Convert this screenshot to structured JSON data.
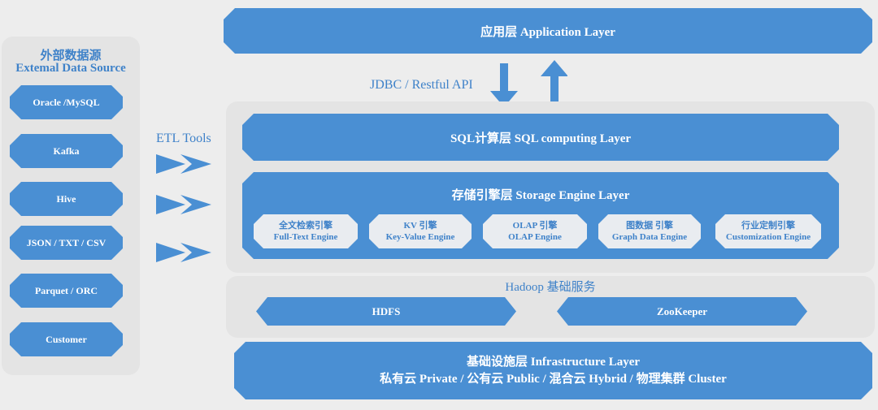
{
  "external": {
    "title_cn": "外部数据源",
    "title_en": "Extemal Data Source",
    "sources": [
      "Oracle /MySQL",
      "Kafka",
      "Hive",
      "JSON / TXT / CSV",
      "Parquet / ORC",
      "Customer"
    ]
  },
  "etl_label": "ETL Tools",
  "application_layer": "应用层 Application Layer",
  "api_label": "JDBC /  Restful API",
  "sql_layer": "SQL计算层   SQL computing Layer",
  "storage": {
    "title": "存储引擎层   Storage Engine Layer",
    "engines": [
      {
        "cn": "全文检索引擎",
        "en": "Full-Text Engine"
      },
      {
        "cn": "KV 引擎",
        "en": "Key-Value Engine"
      },
      {
        "cn": "OLAP 引擎",
        "en": "OLAP  Engine"
      },
      {
        "cn": "图数据 引擎",
        "en": "Graph Data Engine"
      },
      {
        "cn": "行业定制引擎",
        "en": "Customization Engine"
      }
    ]
  },
  "hadoop": {
    "title": "Hadoop 基础服务",
    "services": [
      "HDFS",
      "ZooKeeper"
    ]
  },
  "infrastructure": {
    "title": "基础设施层 Infrastructure Layer",
    "subtitle": "私有云 Private / 公有云 Public / 混合云 Hybrid / 物理集群 Cluster"
  },
  "colors": {
    "accent": "#4a8fd3",
    "panel": "#e4e4e4",
    "label": "#3f82c9"
  }
}
